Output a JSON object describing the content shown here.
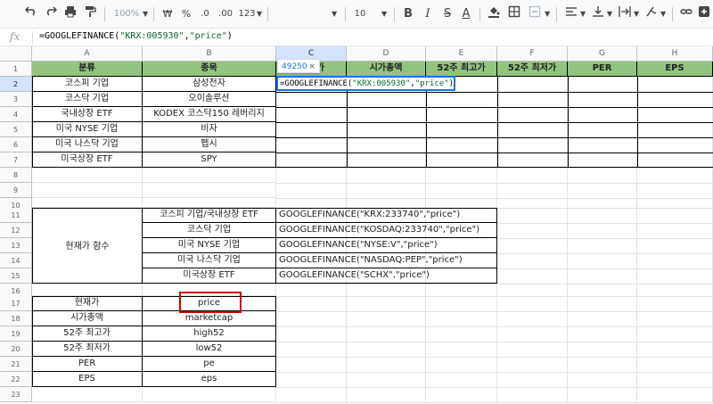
{
  "toolbar": {
    "undo_icon": "undo-icon",
    "redo_icon": "redo-icon",
    "print_icon": "print-icon",
    "paint_format_icon": "paint-format-icon",
    "zoom": "100%",
    "currency": "₩",
    "percent": "%",
    "decrease_decimals": ".0",
    "increase_decimals": ".00",
    "more_formats": "123",
    "font_size": "10",
    "bold": "B",
    "italic": "I",
    "strikethrough": "S",
    "text_color": "A"
  },
  "formula_bar": {
    "fx_label": "fx",
    "formula_prefix": "=GOOGLEFINANCE(",
    "formula_arg1": "\"KRX:005930\"",
    "formula_comma": ",",
    "formula_arg2": "\"price\"",
    "formula_suffix": ")"
  },
  "columns": [
    "A",
    "B",
    "C",
    "D",
    "E",
    "F",
    "G",
    "H"
  ],
  "rows": [
    "1",
    "2",
    "3",
    "4",
    "5",
    "6",
    "7",
    "8",
    "9",
    "10",
    "11",
    "12",
    "13",
    "14",
    "15",
    "16",
    "17",
    "18",
    "19",
    "20",
    "21",
    "22",
    "23"
  ],
  "header_row": {
    "a": "분류",
    "b": "종목",
    "c": "가",
    "d": "시가총액",
    "e": "52주 최고가",
    "f": "52주 최저가",
    "g": "PER",
    "h": "EPS"
  },
  "stock_rows": [
    {
      "category": "코스피 기업",
      "name": "삼성전자"
    },
    {
      "category": "코스닥 기업",
      "name": "오이솔루션"
    },
    {
      "category": "국내상장 ETF",
      "name": "KODEX 코스닥150 레버리지"
    },
    {
      "category": "미국 NYSE 기업",
      "name": "비자"
    },
    {
      "category": "미국 나스닥 기업",
      "name": "펩시"
    },
    {
      "category": "미국상장 ETF",
      "name": "SPY"
    }
  ],
  "price_function": {
    "label": "현재가 함수",
    "items": [
      {
        "market": "코스피 기업/국내상장 ETF",
        "formula": "GOOGLEFINANCE(\"KRX:233740\",\"price\")"
      },
      {
        "market": "코스닥 기업",
        "formula": "GOOGLEFINANCE(\"KOSDAQ:233740\",\"price\")"
      },
      {
        "market": "미국 NYSE 기업",
        "formula": "GOOGLEFINANCE(\"NYSE:V\",\"price\")"
      },
      {
        "market": "미국 나스닥 기업",
        "formula": "GOOGLEFINANCE(\"NASDAQ:PEP\",\"price\")"
      },
      {
        "market": "미국상장 ETF",
        "formula": "GOOGLEFINANCE(\"SCHX\",\"price\")"
      }
    ]
  },
  "attributes": [
    {
      "label": "현재가",
      "attr": "price"
    },
    {
      "label": "시가총액",
      "attr": "marketcap"
    },
    {
      "label": "52주 최고가",
      "attr": "high52"
    },
    {
      "label": "52주 최저가",
      "attr": "low52"
    },
    {
      "label": "PER",
      "attr": "pe"
    },
    {
      "label": "EPS",
      "attr": "eps"
    }
  ],
  "editing": {
    "tooltip_value": "49250",
    "tooltip_close": "×",
    "editor_prefix": "=GOOGLEFINANCE(",
    "editor_arg1": "\"KRX:005930\"",
    "editor_comma": ",",
    "editor_arg2": "\"price\"",
    "editor_suffix": ")"
  },
  "colors": {
    "header_fill": "#93c47d",
    "highlight_border": "#cc0000",
    "selection": "#1a73e8"
  }
}
